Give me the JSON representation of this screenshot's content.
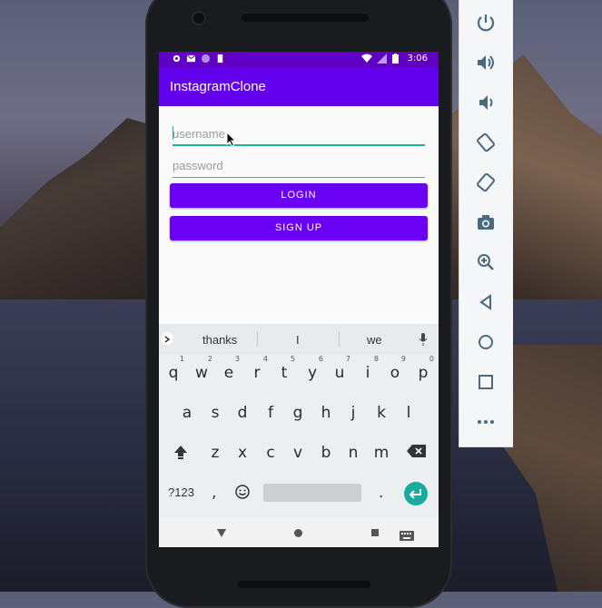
{
  "status_bar": {
    "time": "3:06"
  },
  "app": {
    "title": "InstagramClone"
  },
  "form": {
    "username_placeholder": "username",
    "password_placeholder": "password",
    "login_label": "LOGIN",
    "signup_label": "SIGN UP"
  },
  "keyboard": {
    "suggestions": [
      "thanks",
      "I",
      "we"
    ],
    "row1": [
      "q",
      "w",
      "e",
      "r",
      "t",
      "y",
      "u",
      "i",
      "o",
      "p"
    ],
    "row1_hints": [
      "1",
      "2",
      "3",
      "4",
      "5",
      "6",
      "7",
      "8",
      "9",
      "0"
    ],
    "row2": [
      "a",
      "s",
      "d",
      "f",
      "g",
      "h",
      "j",
      "k",
      "l"
    ],
    "row3": [
      "z",
      "x",
      "c",
      "v",
      "b",
      "n",
      "m"
    ],
    "symbols_label": "?123",
    "comma_label": ",",
    "period_label": "."
  },
  "colors": {
    "primary": "#6200ee",
    "primary_dark": "#5f00c4",
    "accent": "#19b3a6"
  },
  "toolbar": {
    "icons": [
      "power-icon",
      "volume-up-icon",
      "volume-down-icon",
      "rotate-left-icon",
      "rotate-right-icon",
      "camera-icon",
      "zoom-icon",
      "back-icon",
      "home-icon",
      "overview-icon",
      "more-icon"
    ]
  }
}
